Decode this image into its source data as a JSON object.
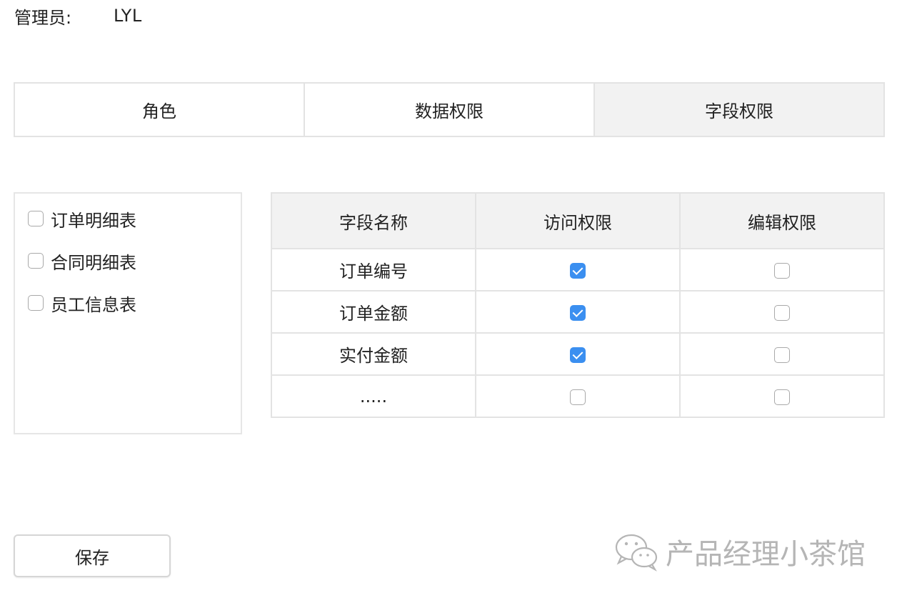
{
  "header": {
    "admin_label": "管理员:",
    "admin_name": "LYL"
  },
  "tabs": [
    {
      "label": "角色",
      "active": false
    },
    {
      "label": "数据权限",
      "active": false
    },
    {
      "label": "字段权限",
      "active": true
    }
  ],
  "table_list": [
    {
      "label": "订单明细表",
      "checked": false
    },
    {
      "label": "合同明细表",
      "checked": false
    },
    {
      "label": "员工信息表",
      "checked": false
    }
  ],
  "permissions": {
    "headers": [
      "字段名称",
      "访问权限",
      "编辑权限"
    ],
    "rows": [
      {
        "field": "订单编号",
        "access": true,
        "edit": false
      },
      {
        "field": "订单金额",
        "access": true,
        "edit": false
      },
      {
        "field": "实付金额",
        "access": true,
        "edit": false
      },
      {
        "field": ".....",
        "access": false,
        "edit": false
      }
    ]
  },
  "actions": {
    "save_label": "保存"
  },
  "watermark": {
    "text": "产品经理小茶馆",
    "icon": "wechat-icon"
  },
  "colors": {
    "accent": "#3b8ff0",
    "border": "#e3e3e3",
    "active_tab_bg": "#f2f2f2",
    "watermark": "#b5b5b5"
  }
}
